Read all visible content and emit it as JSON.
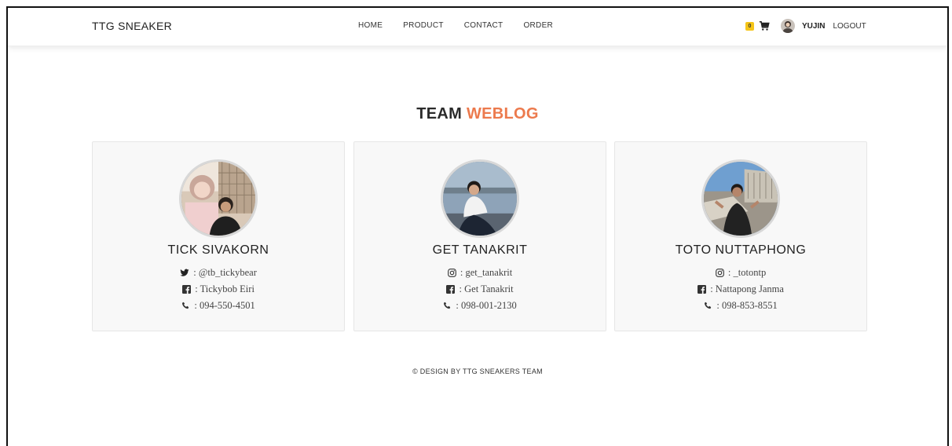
{
  "nav": {
    "brand": "TTG SNEAKER",
    "links": [
      "HOME",
      "PRODUCT",
      "CONTACT",
      "ORDER"
    ],
    "cart_count": "0",
    "username": "YUJIN",
    "logout": "LOGOUT"
  },
  "section": {
    "title_part1": "TEAM",
    "title_part2": "WEBLOG"
  },
  "members": [
    {
      "name": "TICK SIVAKORN",
      "social1_icon": "twitter-icon",
      "social1": ": @tb_tickybear",
      "social2_icon": "facebook-icon",
      "social2": ": Tickybob Eiri",
      "phone_icon": "phone-icon",
      "phone": ": 094-550-4501"
    },
    {
      "name": "GET TANAKRIT",
      "social1_icon": "instagram-icon",
      "social1": ": get_tanakrit",
      "social2_icon": "facebook-icon",
      "social2": ": Get Tanakrit",
      "phone_icon": "phone-icon",
      "phone": ": 098-001-2130"
    },
    {
      "name": "TOTO NUTTAPHONG",
      "social1_icon": "instagram-icon",
      "social1": ": _totontp",
      "social2_icon": "facebook-icon",
      "social2": ": Nattapong Janma",
      "phone_icon": "phone-icon",
      "phone": ": 098-853-8551"
    }
  ],
  "footer": "© DESIGN BY TTG SNEAKERS TEAM",
  "colors": {
    "accent": "#ec7a4d",
    "badge": "#f5c518",
    "card_bg": "#f8f8f8"
  }
}
